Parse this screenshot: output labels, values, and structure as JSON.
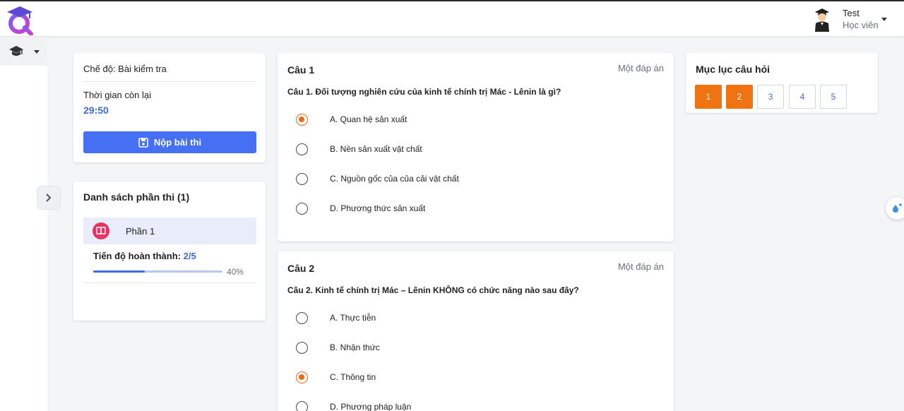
{
  "header": {
    "user_name": "Test",
    "user_role": "Học viên"
  },
  "info": {
    "mode": "Chế độ: Bài kiểm tra",
    "time_label": "Thời gian còn lại",
    "time_value": "29:50",
    "submit_label": "Nộp bài thi"
  },
  "parts": {
    "title": "Danh sách phần thi (1)",
    "items": [
      {
        "label": "Phần 1"
      }
    ],
    "progress_label": "Tiến độ hoàn thành:",
    "progress_value": "2/5",
    "progress_percent": 40,
    "progress_percent_text": "40%"
  },
  "questions": [
    {
      "title": "Câu 1",
      "type": "Một đáp án",
      "text": "Câu 1. Đối tượng nghiên cứu của kinh tế chính trị Mác - Lênin là gì?",
      "options": [
        {
          "label": "A. Quan hệ sản xuất",
          "selected": true
        },
        {
          "label": "B. Nền sản xuất vật chất",
          "selected": false
        },
        {
          "label": "C. Nguồn gốc của của cải vật chất",
          "selected": false
        },
        {
          "label": "D. Phương thức sản xuất",
          "selected": false
        }
      ]
    },
    {
      "title": "Câu 2",
      "type": "Một đáp án",
      "text": "Câu 2. Kinh tế chính trị Mác – Lênin KHÔNG có chức năng nào sau đây?",
      "options": [
        {
          "label": "A. Thực tiễn",
          "selected": false
        },
        {
          "label": "B. Nhận thức",
          "selected": false
        },
        {
          "label": "C. Thông tin",
          "selected": true
        },
        {
          "label": "D. Phương pháp luận",
          "selected": false
        }
      ]
    }
  ],
  "index": {
    "title": "Mục lục câu hỏi",
    "items": [
      {
        "label": "1",
        "answered": true
      },
      {
        "label": "2",
        "answered": true
      },
      {
        "label": "3",
        "answered": false
      },
      {
        "label": "4",
        "answered": false
      },
      {
        "label": "5",
        "answered": false
      }
    ]
  },
  "colors": {
    "primary": "#4570f4",
    "accent": "#f07312",
    "part_icon": "#e8325f"
  },
  "icons": {
    "logo": "graduation-logo-icon",
    "sidebar": "graduation-cap-icon",
    "submit": "save-icon",
    "part": "book-icon",
    "collapse": "chevron-right-icon",
    "float": "water-drop-icon"
  }
}
